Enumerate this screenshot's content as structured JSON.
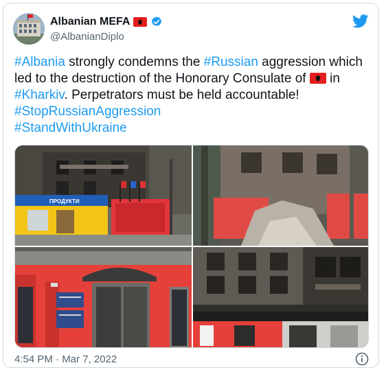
{
  "tweet": {
    "display_name": "Albanian MEFA",
    "handle": "@AlbanianDiplo",
    "text": {
      "part1_tag": "#Albania",
      "part1_rest": " strongly condemns the ",
      "part2_tag": "#Russian",
      "part2_rest": " aggression which led to the destruction of the Honorary Consulate of ",
      "part3_pre": " in ",
      "part3_tag": "#Kharkiv",
      "part3_rest": ". Perpetrators must be held accountable!",
      "hashtag1": "#StopRussianAggression",
      "hashtag2": "#StandWithUkraine"
    },
    "timestamp": "4:54 PM · Mar 7, 2022",
    "shop_sign": "ПРОДУКТИ"
  },
  "icons": {
    "verified": "verified-badge-icon",
    "brand": "twitter-bird-icon",
    "info": "info-icon",
    "flag": "albania-flag-icon"
  },
  "colors": {
    "link": "#1d9bf0",
    "secondary_text": "#536471",
    "border": "#cfd9de",
    "flag_red": "#e41e20"
  }
}
